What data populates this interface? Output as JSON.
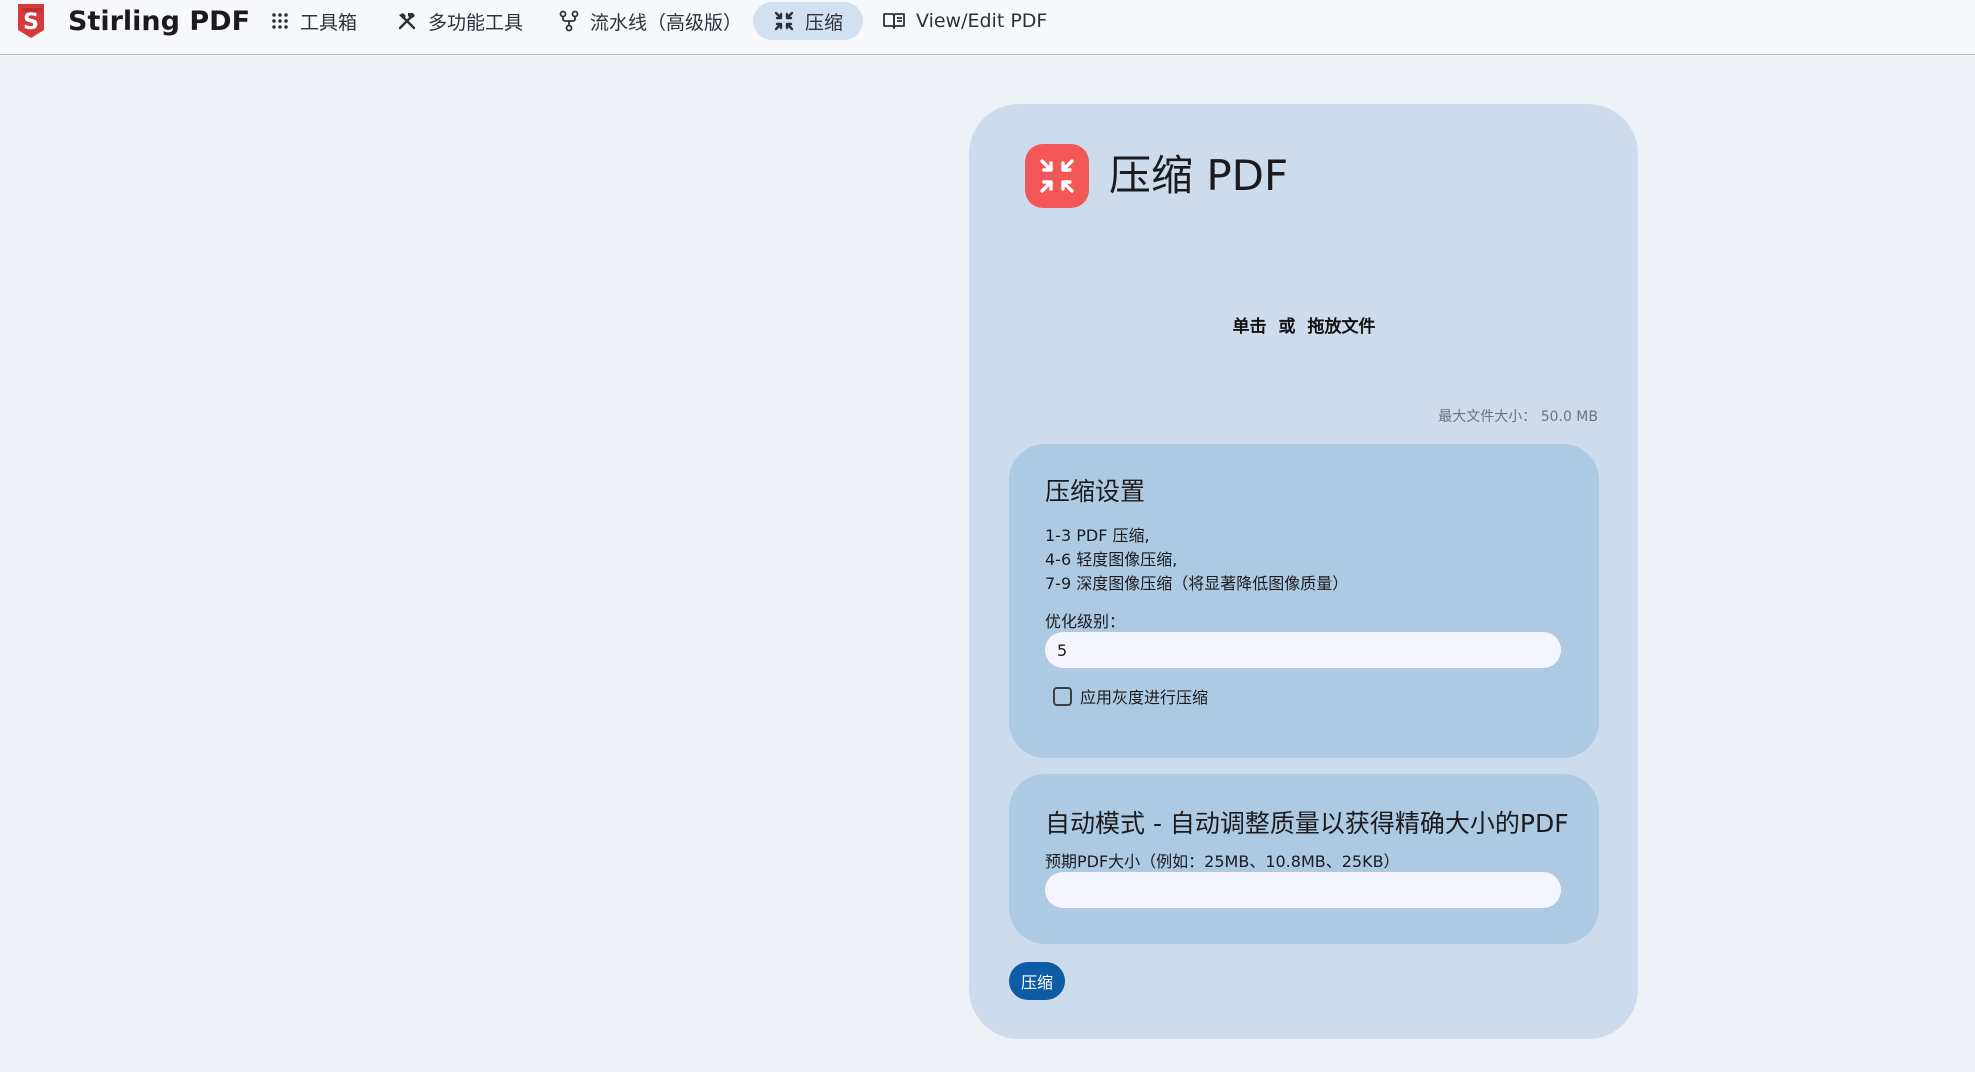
{
  "navbar": {
    "brand": "Stirling PDF",
    "items": [
      {
        "label": "工具箱",
        "icon": "apps-grid-icon"
      },
      {
        "label": "多功能工具",
        "icon": "tools-icon"
      },
      {
        "label": "流水线（高级版）",
        "icon": "pipeline-icon"
      },
      {
        "label": "压缩",
        "icon": "compress-icon",
        "active": true
      },
      {
        "label": "View/Edit PDF",
        "icon": "book-icon"
      }
    ]
  },
  "page": {
    "title": "压缩 PDF",
    "title_icon": "compress-icon",
    "icon_color": "#f45757"
  },
  "dropzone": {
    "click": "单击",
    "or": "或",
    "drag": "拖放文件",
    "max_size_label": "最大文件大小：",
    "max_size_value": "50.0 MB"
  },
  "settings": {
    "title": "压缩设置",
    "lines": [
      "1-3 PDF 压缩,",
      "4-6 轻度图像压缩,",
      "7-9 深度图像压缩（将显著降低图像质量）"
    ],
    "level_label": "优化级别：",
    "level_value": "5",
    "grayscale_label": "应用灰度进行压缩",
    "grayscale_checked": false
  },
  "auto": {
    "title": "自动模式 - 自动调整质量以获得精确大小的PDF",
    "size_label": "预期PDF大小（例如：25MB、10.8MB、25KB）",
    "size_value": ""
  },
  "submit": {
    "label": "压缩",
    "color": "#0f5ca6"
  }
}
